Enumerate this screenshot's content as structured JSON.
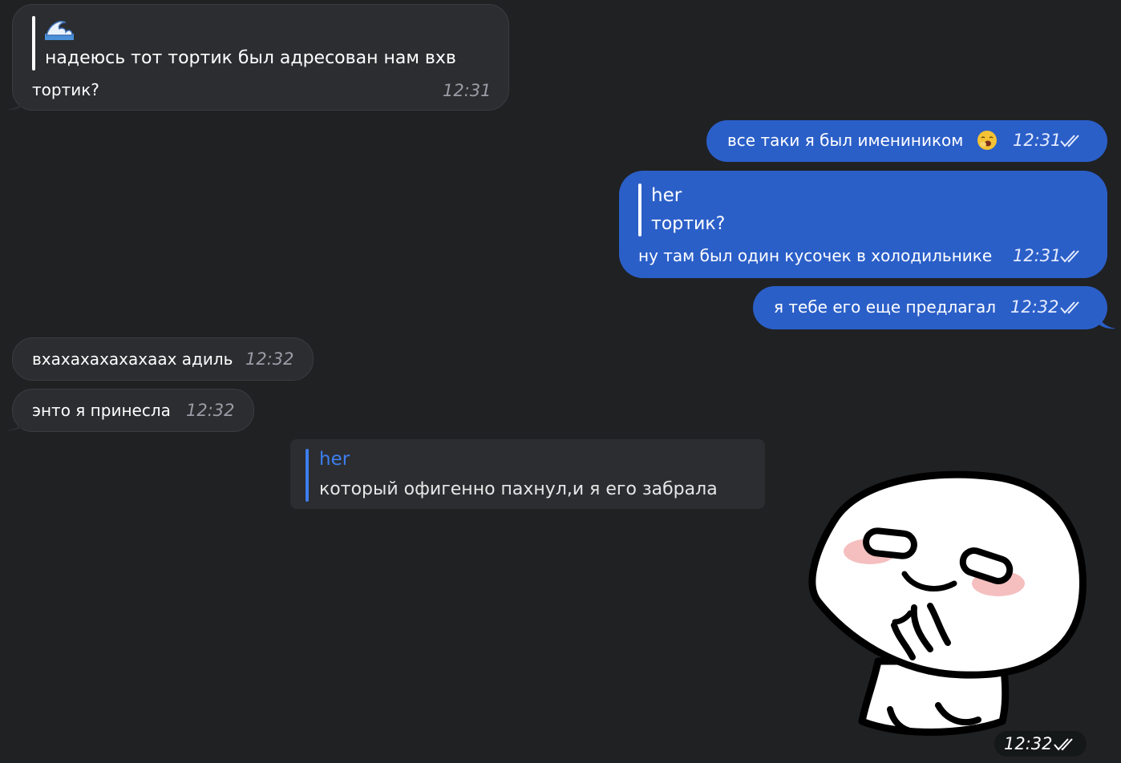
{
  "messages": [
    {
      "id": "m1",
      "direction": "incoming",
      "reply": {
        "sender_icon": "wave-icon",
        "text": "надеюсь тот тортик был адресован нам вхв"
      },
      "text": "тортик?",
      "time": "12:31"
    },
    {
      "id": "m2",
      "direction": "outgoing",
      "text": "все таки я был имениником",
      "emoji": "yawning-face-emoji",
      "time": "12:31",
      "status": "read"
    },
    {
      "id": "m3",
      "direction": "outgoing",
      "reply": {
        "sender": "her",
        "text": "тортик?"
      },
      "text": "ну там был один кусочек в холодильнике",
      "time": "12:31",
      "status": "read"
    },
    {
      "id": "m4",
      "direction": "outgoing",
      "text": "я тебе его еще предлагал",
      "time": "12:32",
      "status": "read"
    },
    {
      "id": "m5",
      "direction": "incoming",
      "text": "вхахахахахахаах адиль",
      "time": "12:32"
    },
    {
      "id": "m6",
      "direction": "incoming",
      "text": "энто я принесла",
      "time": "12:32"
    },
    {
      "id": "m7",
      "direction": "outgoing",
      "reply": {
        "sender": "her",
        "text": "который офигенно пахнул,и я его забрала"
      },
      "sticker": "shy-blushing-character-sticker",
      "time": "12:32",
      "status": "read"
    }
  ],
  "colors": {
    "background": "#1f2123",
    "incoming_bubble": "#2b2d30",
    "outgoing_bubble": "#2b5fc8",
    "reply_accent": "#3d7ef0",
    "timestamp_incoming": "#9a9da6"
  }
}
